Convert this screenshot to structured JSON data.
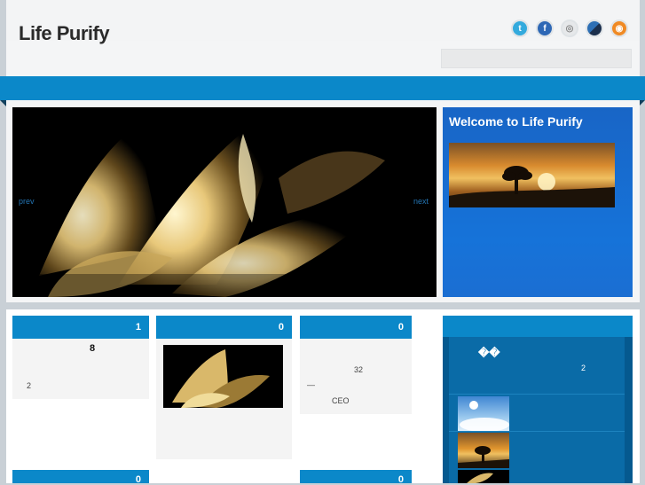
{
  "header": {
    "logo": "Life Purify"
  },
  "social": [
    "twitter-icon",
    "facebook-icon",
    "delicious-icon",
    "digg-icon",
    "rss-icon"
  ],
  "slider": {
    "prev": "prev",
    "next": "next"
  },
  "welcome": {
    "title": "Welcome to Life Purify"
  },
  "cards": [
    {
      "count": "1",
      "line1": "8",
      "line2": "2"
    },
    {
      "count": "0"
    },
    {
      "count": "0",
      "line1": "32",
      "line2": "—",
      "line3": "CEO"
    }
  ],
  "cards_row2": [
    {
      "count": "0"
    },
    {
      "count": "0"
    }
  ],
  "sidebar": {
    "symbols": "��",
    "count": "2"
  },
  "colors": {
    "nav_blue": "#0b88c9",
    "sidebar_blue": "#05598f",
    "welcome_blue": "#1673d9"
  }
}
